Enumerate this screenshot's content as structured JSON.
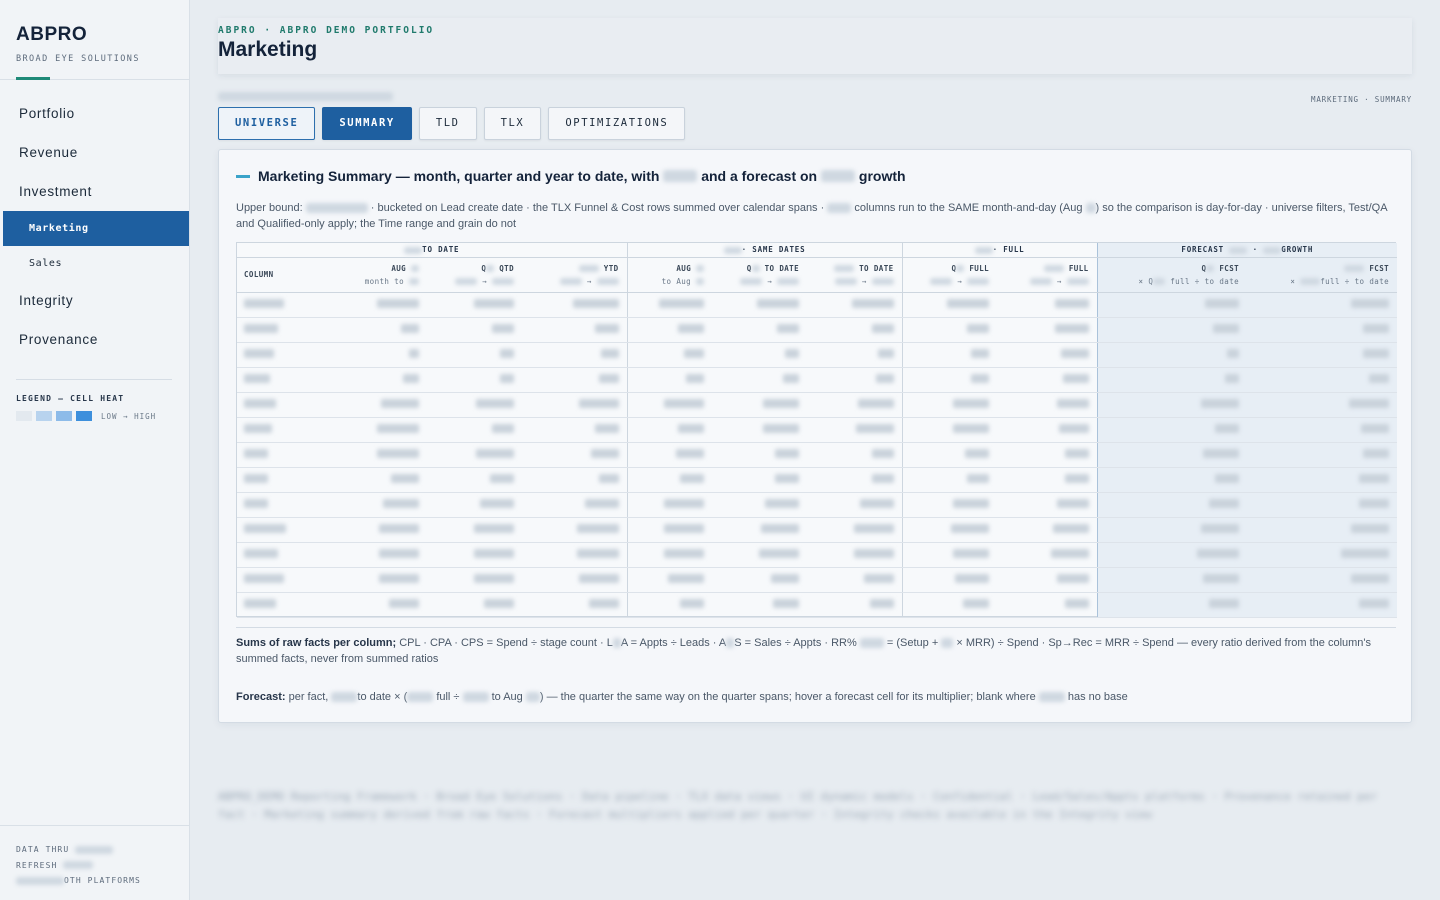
{
  "brand": {
    "name": "ABPRO",
    "subtitle": "BROAD EYE SOLUTIONS"
  },
  "sidebar": {
    "items": [
      {
        "label": "Portfolio"
      },
      {
        "label": "Revenue"
      },
      {
        "label": "Investment"
      },
      {
        "label": "Marketing",
        "active": true,
        "sub": true
      },
      {
        "label": "Sales",
        "sub": true
      },
      {
        "label": "Integrity"
      },
      {
        "label": "Provenance"
      }
    ],
    "legend": {
      "title": "LEGEND — CELL HEAT",
      "range": "LOW → HIGH",
      "colors": [
        "#e3e9ef",
        "#b8d3ee",
        "#8dbbe9",
        "#3d8fdc"
      ]
    },
    "footer": {
      "data_thru": "DATA THRU",
      "refresh": "REFRESH",
      "platforms": "OTH PLATFORMS"
    }
  },
  "header": {
    "crumb": "ABPRO · ABPRO DEMO PORTFOLIO",
    "title": "Marketing",
    "trail": "MARKETING · SUMMARY"
  },
  "tabs": [
    {
      "label": "UNIVERSE",
      "state": "outlined"
    },
    {
      "label": "SUMMARY",
      "state": "active"
    },
    {
      "label": "TLD",
      "state": "normal"
    },
    {
      "label": "TLX",
      "state": "normal"
    },
    {
      "label": "OPTIMIZATIONS",
      "state": "normal"
    }
  ],
  "card": {
    "title_a": "Marketing Summary — month, quarter and year to date, with",
    "title_b": "and a forecast on",
    "title_c": "growth",
    "desc_a": "Upper bound:",
    "desc_b": "· bucketed on Lead create date · the TLX Funnel & Cost rows summed over calendar spans ·",
    "desc_c": "columns run to the SAME month-and-day (Aug",
    "desc_d": ") so the comparison is day-for-day · universe filters, Test/QA and Qualified-only apply; the Time range and grain do not",
    "note1_head": "Sums of raw facts per column;",
    "note1_a": "CPL · CPA · CPS = Spend ÷ stage count · L",
    "note1_b": "A = Appts ÷ Leads · A",
    "note1_c": "S = Sales ÷ Appts · RR%",
    "note1_d": "= (Setup +",
    "note1_e": "× MRR) ÷ Spend · Sp→Rec = MRR ÷ Spend — every ratio derived from the column's summed facts, never from summed ratios",
    "note2_head": "Forecast:",
    "note2_a": "per fact,",
    "note2_b": "to date × (",
    "note2_c": "full ÷",
    "note2_d": "to Aug",
    "note2_e": ") — the quarter the same way on the quarter spans; hover a forecast cell for its multiplier; blank where",
    "note2_f": "has no base"
  },
  "table": {
    "groups": [
      "TO DATE",
      "· SAME DATES",
      "· FULL",
      "FORECAST",
      "·",
      "GROWTH"
    ],
    "col_label": "COLUMN",
    "subheaders": [
      {
        "l1": "AUG",
        "l2": "month to"
      },
      {
        "l1": "Q",
        "l1b": "QTD",
        "l2": "→"
      },
      {
        "l1": "YTD",
        "l2": "→"
      },
      {
        "l1": "AUG",
        "l2": "to Aug"
      },
      {
        "l1": "Q",
        "l1b": "TO DATE",
        "l2": "→"
      },
      {
        "l1": "TO DATE",
        "l2": "→"
      },
      {
        "l1": "Q",
        "l1b": "FULL",
        "l2": "→"
      },
      {
        "l1": "FULL",
        "l2": "→"
      },
      {
        "l1": "Q",
        "l1b": "FCST",
        "l2": "× Q",
        "l2b": "full ÷ to date"
      },
      {
        "l1": "FCST",
        "l2": "×",
        "l2b": "full ÷ to date"
      }
    ],
    "row_count": 13
  },
  "footer_text": "ABPRO_DEMO Reporting Framework · Broad Eye Solutions · Data pipeline · TLX data views · UI dynamic models · Confidential · Lead/Sales/Appts platforms · Provenance retained per fact · Marketing summary derived from raw facts · Forecast multipliers applied per quarter · Integrity checks available in the Integrity view"
}
